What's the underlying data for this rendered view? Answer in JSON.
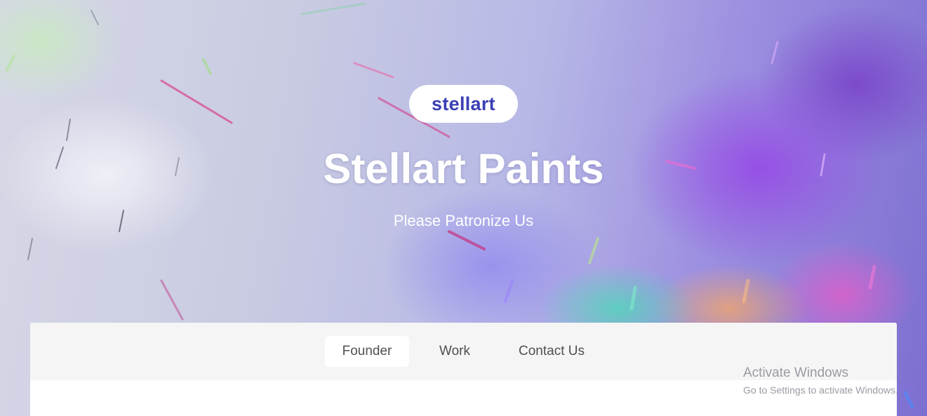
{
  "header": {
    "logo_text": "stellart",
    "title": "Stellart Paints",
    "subtitle": "Please Patronize Us"
  },
  "tabs": [
    {
      "label": "Founder",
      "active": true
    },
    {
      "label": "Work",
      "active": false
    },
    {
      "label": "Contact Us",
      "active": false
    }
  ],
  "os_watermark": {
    "title": "Activate Windows",
    "subtitle": "Go to Settings to activate Windows."
  },
  "colors": {
    "logo_text": "#3b3fb4",
    "tab_bar_background": "#f5f5f5",
    "tab_text": "#505050",
    "hero_text": "#ffffff"
  }
}
